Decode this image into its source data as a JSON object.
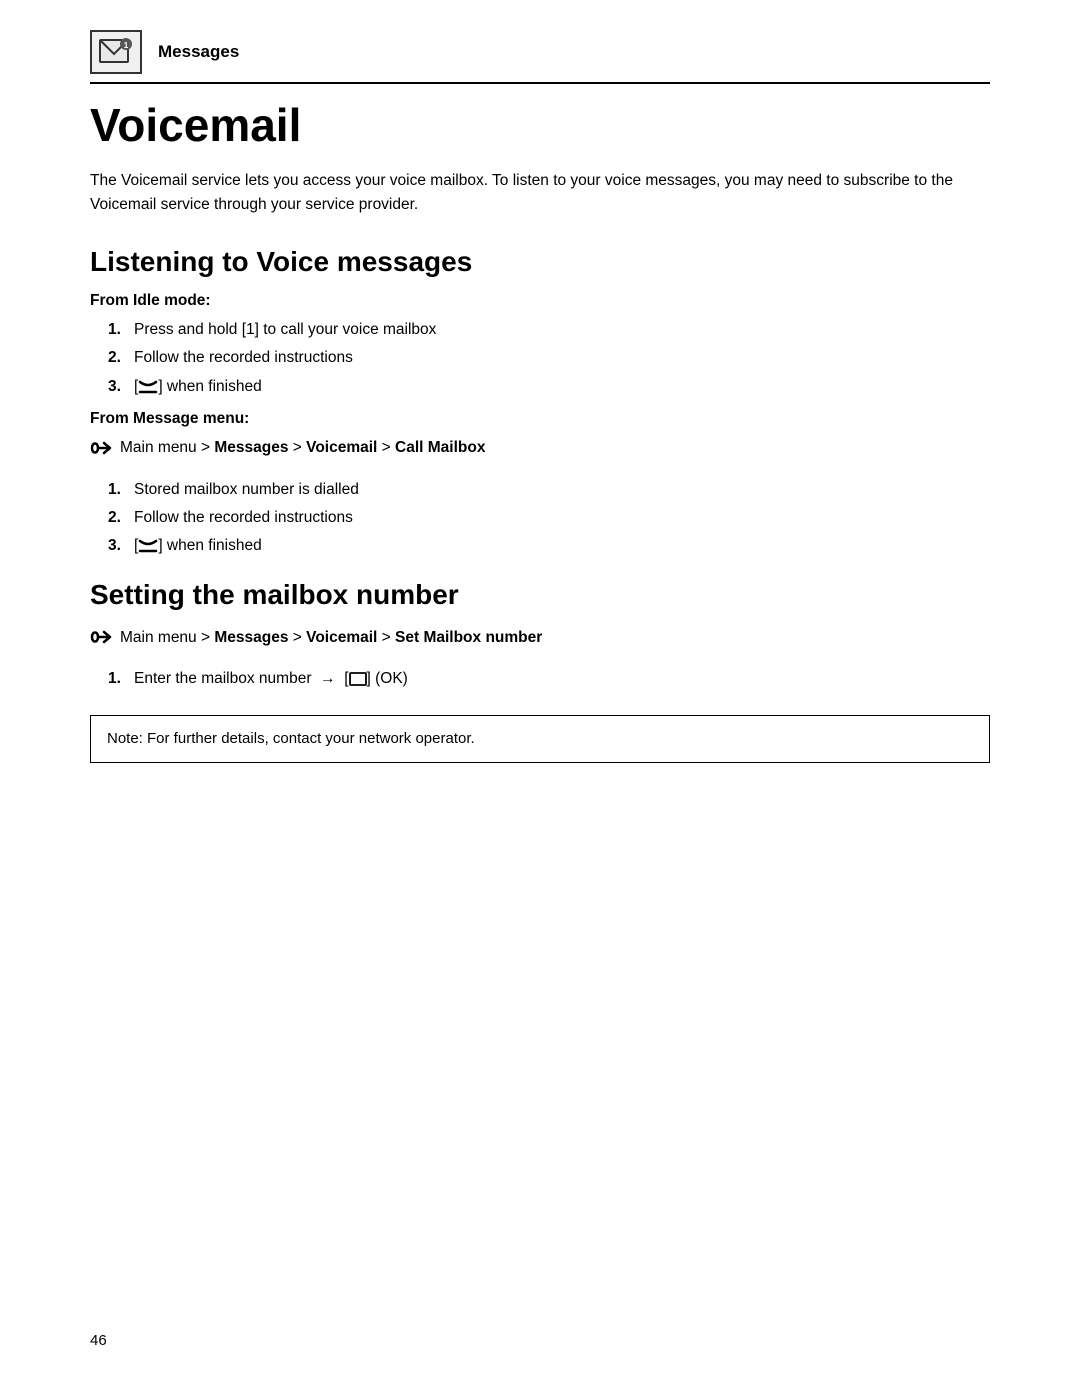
{
  "header": {
    "title": "Messages"
  },
  "page": {
    "title": "Voicemail",
    "intro": "The Voicemail service lets you access your voice mailbox. To listen to your voice messages, you may need to subscribe to the Voicemail service through your service provider.",
    "section1": {
      "title": "Listening to Voice messages",
      "subsection1": {
        "label": "From Idle mode:",
        "steps": [
          "Press and hold [1] to call your voice mailbox",
          "Follow the recorded instructions",
          "[✕] when finished"
        ]
      },
      "subsection2": {
        "label": "From Message menu:",
        "nav": "Main menu > Messages > Voicemail > Call Mailbox",
        "steps": [
          "Stored mailbox number is dialled",
          "Follow the recorded instructions",
          "[✕] when finished"
        ]
      }
    },
    "section2": {
      "title": "Setting the mailbox number",
      "nav": "Main menu > Messages > Voicemail > Set Mailbox number",
      "steps": [
        "Enter the mailbox number → [□] (OK)"
      ]
    },
    "note": "Note: For further details, contact your network operator.",
    "page_number": "46"
  }
}
